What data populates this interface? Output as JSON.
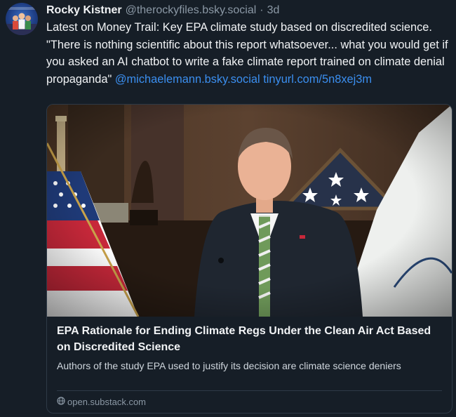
{
  "author": {
    "name": "Rocky Kistner",
    "handle": "@therockyfiles.bsky.social",
    "separator": "·",
    "time": "3d"
  },
  "post": {
    "text": "Latest on Money Trail: Key EPA climate study based on discredited science. \"There is nothing scientific about this report whatsoever... what you would get if you asked an AI chatbot to write a fake climate report trained on climate denial propaganda\"",
    "mention": "@michaelemann.bsky.social",
    "link": "tinyurl.com/5n8xej3m"
  },
  "card": {
    "title": "EPA Rationale for Ending Climate Regs Under the Clean Air Act Based on Discredited Science",
    "description": "Authors of the study EPA used to justify its decision are climate science deniers",
    "domain": "open.substack.com"
  },
  "colors": {
    "background": "#161e27",
    "text": "#f1f3f5",
    "muted": "#8b98a5",
    "link": "#3b8ff0",
    "border": "#2e3a47"
  },
  "icons": {
    "card_domain": "globe-icon"
  }
}
